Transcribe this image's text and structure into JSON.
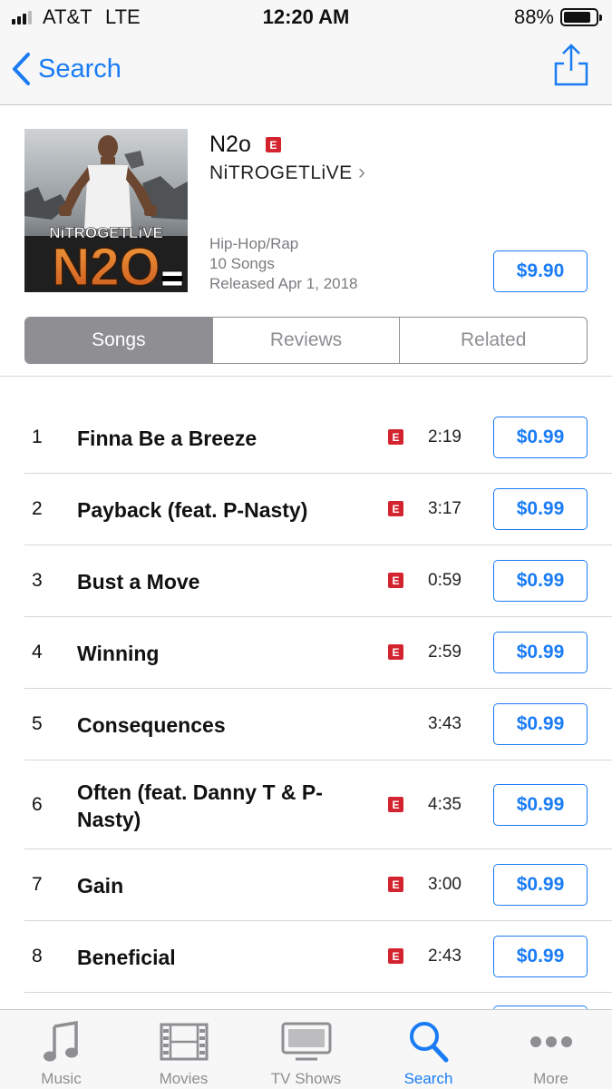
{
  "status_bar": {
    "carrier": "AT&T",
    "network": "LTE",
    "time": "12:20 AM",
    "battery_percent": "88%",
    "battery_level": 0.88,
    "signal_bars_filled": 3
  },
  "nav": {
    "back_label": "Search",
    "back_icon": "chevron-left-icon",
    "share_icon": "share-icon",
    "accent_color": "#1a7cf5"
  },
  "album": {
    "title": "N2o",
    "explicit_badge": "E",
    "artist": "NiTROGETLiVE",
    "artist_chevron": "›",
    "genre": "Hip-Hop/Rap",
    "song_count": "10 Songs",
    "release": "Released Apr 1, 2018",
    "price": "$9.90",
    "art": {
      "artist_text": "NiTROGETLiVE",
      "title_text": "N2O",
      "advisory_text": "PARENTAL ADVISORY EXPLICIT CONTENT"
    }
  },
  "segments": [
    {
      "label": "Songs",
      "active": true
    },
    {
      "label": "Reviews",
      "active": false
    },
    {
      "label": "Related",
      "active": false
    }
  ],
  "songs": [
    {
      "number": "1",
      "title": "Finna Be a Breeze",
      "explicit": "E",
      "duration": "2:19",
      "price": "$0.99"
    },
    {
      "number": "2",
      "title": "Payback (feat. P-Nasty)",
      "explicit": "E",
      "duration": "3:17",
      "price": "$0.99"
    },
    {
      "number": "3",
      "title": "Bust a Move",
      "explicit": "E",
      "duration": "0:59",
      "price": "$0.99"
    },
    {
      "number": "4",
      "title": "Winning",
      "explicit": "E",
      "duration": "2:59",
      "price": "$0.99"
    },
    {
      "number": "5",
      "title": "Consequences",
      "explicit": "",
      "duration": "3:43",
      "price": "$0.99"
    },
    {
      "number": "6",
      "title": "Often (feat. Danny T & P-Nasty)",
      "explicit": "E",
      "duration": "4:35",
      "price": "$0.99"
    },
    {
      "number": "7",
      "title": "Gain",
      "explicit": "E",
      "duration": "3:00",
      "price": "$0.99"
    },
    {
      "number": "8",
      "title": "Beneficial",
      "explicit": "E",
      "duration": "2:43",
      "price": "$0.99"
    }
  ],
  "tabs": [
    {
      "label": "Music",
      "icon": "music-note-icon",
      "active": false
    },
    {
      "label": "Movies",
      "icon": "film-icon",
      "active": false
    },
    {
      "label": "TV Shows",
      "icon": "tv-icon",
      "active": false
    },
    {
      "label": "Search",
      "icon": "search-icon",
      "active": true
    },
    {
      "label": "More",
      "icon": "more-icon",
      "active": false
    }
  ],
  "colors": {
    "accent": "#1a7cf5",
    "explicit_red": "#d3242f",
    "segment_gray": "#8e8e93"
  }
}
